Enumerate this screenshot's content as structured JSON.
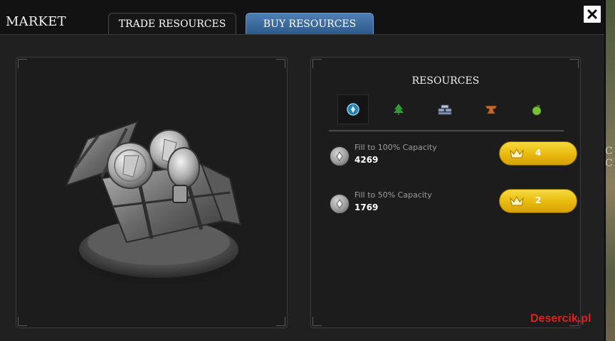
{
  "window": {
    "title": "MARKET"
  },
  "tabs": [
    {
      "label": "TRADE RESOURCES",
      "active": false
    },
    {
      "label": "BUY RESOURCES",
      "active": true
    }
  ],
  "close": {
    "icon": "close-icon"
  },
  "image_panel": {
    "icon": "treasure-chest-image"
  },
  "resources": {
    "heading": "RESOURCES",
    "types": [
      {
        "icon": "silver-coin-icon",
        "color": "#3aa6c6",
        "active": true
      },
      {
        "icon": "tree-icon",
        "color": "#2f9a3a",
        "active": false
      },
      {
        "icon": "stone-bricks-icon",
        "color": "#9aa8c8",
        "active": false
      },
      {
        "icon": "anvil-icon",
        "color": "#c86a2a",
        "active": false
      },
      {
        "icon": "apple-icon",
        "color": "#7cc03a",
        "active": false
      }
    ],
    "options": [
      {
        "label": "Fill to 100% Capacity",
        "amount": "4269",
        "cost": "4",
        "icon": "silver-icon",
        "button_icon": "crown-icon"
      },
      {
        "label": "Fill to 50% Capacity",
        "amount": "1769",
        "cost": "2",
        "icon": "silver-icon",
        "button_icon": "crown-icon"
      }
    ]
  },
  "background_text": {
    "line1": "C",
    "line2": "C"
  },
  "watermark": "Desercik.pl",
  "colors": {
    "button_gold": "#e9b90e",
    "tab_active_blue": "#3d6fa4",
    "watermark_red": "#e02020"
  }
}
